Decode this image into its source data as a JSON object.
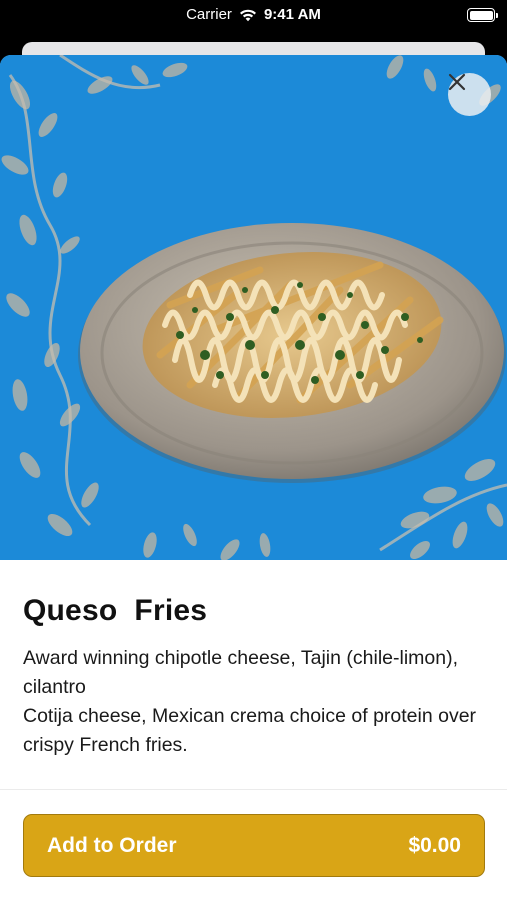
{
  "status_bar": {
    "carrier": "Carrier",
    "time": "9:41 AM",
    "wifi_icon": "wifi-icon",
    "battery_icon": "battery-icon"
  },
  "hero": {
    "background_color": "#1c8ad8",
    "close_icon": "close-icon"
  },
  "item": {
    "title": "Queso  Fries",
    "description_line_1": "Award winning chipotle cheese, Tajin (chile-limon), cilantro",
    "description_line_2": "Cotija cheese, Mexican crema choice of protein over crispy French fries."
  },
  "footer": {
    "add_label": "Add to Order",
    "price": "$0.00",
    "button_color": "#d9a516"
  }
}
